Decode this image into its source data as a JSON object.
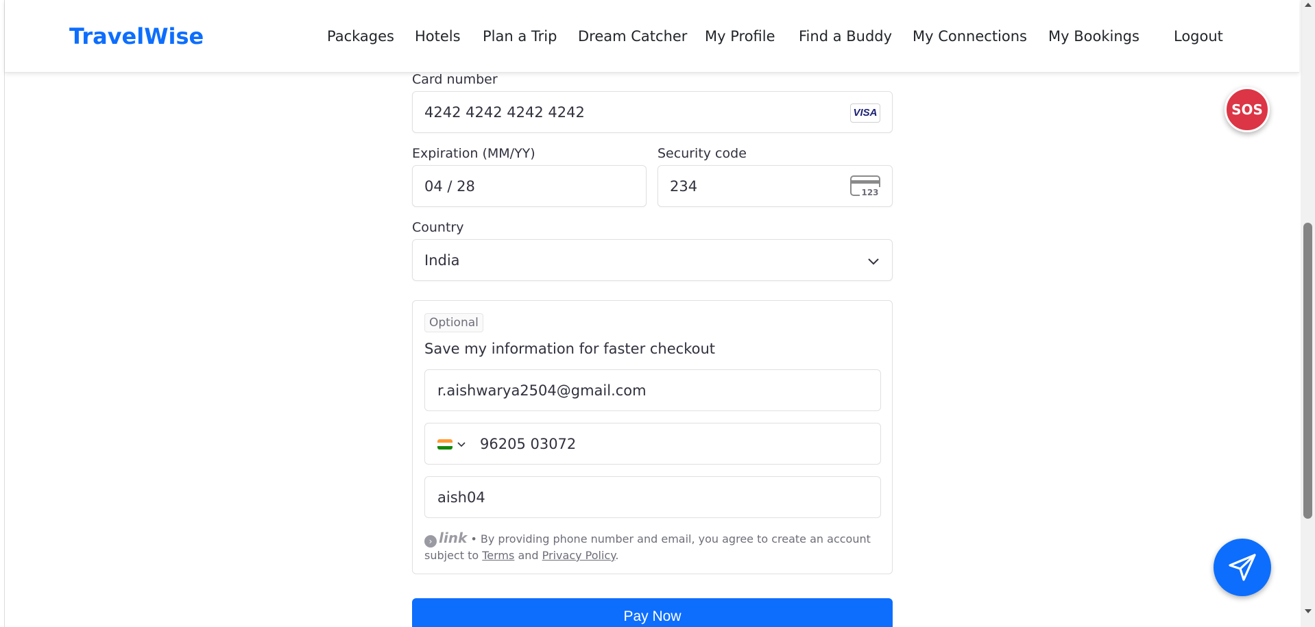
{
  "navbar": {
    "brand": "TravelWise",
    "links": [
      "Packages",
      "Hotels",
      "Plan a Trip",
      "Dream Catcher",
      "My Profile",
      "Find a Buddy",
      "My Connections",
      "My Bookings",
      "Logout"
    ]
  },
  "payment_form": {
    "card_number_label": "Card number",
    "card_number_value": "4242 4242 4242 4242",
    "card_brand": "VISA",
    "expiration_label": "Expiration (MM/YY)",
    "expiration_value": "04 / 28",
    "security_code_label": "Security code",
    "security_code_value": "234",
    "cvc_icon_text": "123",
    "country_label": "Country",
    "country_value": "India"
  },
  "link_save": {
    "badge": "Optional",
    "title": "Save my information for faster checkout",
    "email": "r.aishwarya2504@gmail.com",
    "phone": "96205 03072",
    "name": "aish04",
    "link_logo": "link",
    "legal_text": "• By providing phone number and email, you agree to create an account subject to",
    "terms": "Terms",
    "and": "and",
    "privacy": "Privacy Policy",
    "period": "."
  },
  "pay_button": "Pay Now",
  "sos_label": "SOS",
  "colors": {
    "brand": "#0d6efd",
    "sos": "#dc3545",
    "pay_button": "#0d6efd"
  },
  "icons": [
    "visa-card-icon",
    "cvc-card-icon",
    "chevron-down-icon",
    "india-flag-icon",
    "send-icon"
  ]
}
